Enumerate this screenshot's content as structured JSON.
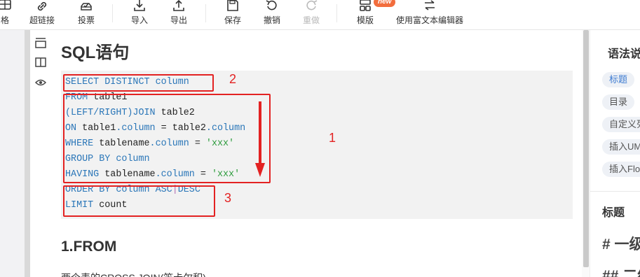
{
  "toolbar": {
    "items": [
      {
        "key": "table",
        "label": "格"
      },
      {
        "key": "link",
        "label": "超链接"
      },
      {
        "key": "vote",
        "label": "投票"
      },
      {
        "key": "import",
        "label": "导入"
      },
      {
        "key": "export",
        "label": "导出"
      },
      {
        "key": "save",
        "label": "保存"
      },
      {
        "key": "undo",
        "label": "撤销"
      },
      {
        "key": "redo",
        "label": "重做"
      },
      {
        "key": "template",
        "label": "模版"
      },
      {
        "key": "rich_text",
        "label": "使用富文本编辑器"
      }
    ],
    "new_badge": "new"
  },
  "editor": {
    "title": "SQL语句",
    "code_lines": [
      [
        {
          "t": "SELECT DISTINCT column",
          "c": "kw"
        }
      ],
      [
        {
          "t": "FROM",
          "c": "kw"
        },
        {
          "t": " table1",
          "c": ""
        }
      ],
      [
        {
          "t": "(LEFT/RIGHT)JOIN",
          "c": "kw"
        },
        {
          "t": " table2",
          "c": ""
        }
      ],
      [
        {
          "t": "ON",
          "c": "kw"
        },
        {
          "t": " table1",
          "c": ""
        },
        {
          "t": ".column",
          "c": "kw"
        },
        {
          "t": " = ",
          "c": ""
        },
        {
          "t": "table2",
          "c": ""
        },
        {
          "t": ".column",
          "c": "kw"
        }
      ],
      [
        {
          "t": "WHERE",
          "c": "kw"
        },
        {
          "t": " tablename",
          "c": ""
        },
        {
          "t": ".column",
          "c": "kw"
        },
        {
          "t": " = ",
          "c": ""
        },
        {
          "t": "'xxx'",
          "c": "str"
        }
      ],
      [
        {
          "t": "GROUP BY column",
          "c": "kw"
        }
      ],
      [
        {
          "t": "HAVING",
          "c": "kw"
        },
        {
          "t": " tablename",
          "c": ""
        },
        {
          "t": ".column",
          "c": "kw"
        },
        {
          "t": " = ",
          "c": ""
        },
        {
          "t": "'xxx'",
          "c": "str"
        }
      ],
      [
        {
          "t": "ORDER BY column ASC",
          "c": "kw"
        },
        {
          "t": "|",
          "c": "op"
        },
        {
          "t": "DESC",
          "c": "kw"
        }
      ],
      [
        {
          "t": "LIMIT",
          "c": "kw"
        },
        {
          "t": " count",
          "c": ""
        }
      ]
    ],
    "annotations": [
      "2",
      "1",
      "3"
    ],
    "subheading": "1.FROM",
    "paragraph": "两个表的CROSS JOIN(笛卡尔积)"
  },
  "help_panel": {
    "title": "语法说明",
    "tags": [
      "标题",
      "目录",
      "自定义列表",
      "插入UML图",
      "插入Flowchart"
    ],
    "section": "标题",
    "example_h1": "# 一级标题",
    "example_h2": "## 二级标题"
  },
  "colors": {
    "keyword": "#2a76b8",
    "string": "#2e9c3e",
    "annotation": "#e32222",
    "badge": "#f26d3d"
  }
}
